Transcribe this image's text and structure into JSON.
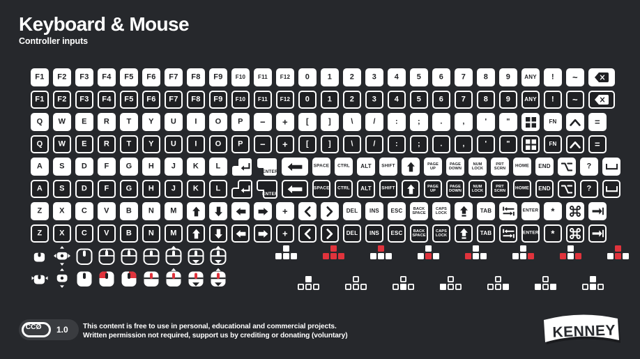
{
  "header": {
    "title": "Keyboard & Mouse",
    "subtitle": "Controller inputs"
  },
  "colors": {
    "background": "#26282c",
    "key_fill": "#ffffff",
    "key_dark": "#1f2023",
    "accent_red": "#e0333c",
    "badge_bg": "#3a3c40"
  },
  "keyboard": {
    "rows": [
      {
        "style": "solid",
        "keys": [
          {
            "label": "F1"
          },
          {
            "label": "F2"
          },
          {
            "label": "F3"
          },
          {
            "label": "F4"
          },
          {
            "label": "F5"
          },
          {
            "label": "F6"
          },
          {
            "label": "F7"
          },
          {
            "label": "F8"
          },
          {
            "label": "F9"
          },
          {
            "label": "F10"
          },
          {
            "label": "F11"
          },
          {
            "label": "F12"
          },
          {
            "label": "0"
          },
          {
            "label": "1"
          },
          {
            "label": "2"
          },
          {
            "label": "3"
          },
          {
            "label": "4"
          },
          {
            "label": "5"
          },
          {
            "label": "6"
          },
          {
            "label": "7"
          },
          {
            "label": "8"
          },
          {
            "label": "9"
          },
          {
            "label": "ANY"
          },
          {
            "label": "!"
          },
          {
            "label": "~"
          },
          {
            "label": "",
            "icon": "backspace-icon"
          }
        ]
      },
      {
        "style": "outline",
        "keys": [
          {
            "label": "F1"
          },
          {
            "label": "F2"
          },
          {
            "label": "F3"
          },
          {
            "label": "F4"
          },
          {
            "label": "F5"
          },
          {
            "label": "F6"
          },
          {
            "label": "F7"
          },
          {
            "label": "F8"
          },
          {
            "label": "F9"
          },
          {
            "label": "F10"
          },
          {
            "label": "F11"
          },
          {
            "label": "F12"
          },
          {
            "label": "0"
          },
          {
            "label": "1"
          },
          {
            "label": "2"
          },
          {
            "label": "3"
          },
          {
            "label": "4"
          },
          {
            "label": "5"
          },
          {
            "label": "6"
          },
          {
            "label": "7"
          },
          {
            "label": "8"
          },
          {
            "label": "9"
          },
          {
            "label": "ANY"
          },
          {
            "label": "!"
          },
          {
            "label": "~"
          },
          {
            "label": "",
            "icon": "backspace-icon"
          }
        ]
      },
      {
        "style": "solid",
        "keys": [
          {
            "label": "Q"
          },
          {
            "label": "W"
          },
          {
            "label": "E"
          },
          {
            "label": "R"
          },
          {
            "label": "T"
          },
          {
            "label": "Y"
          },
          {
            "label": "U"
          },
          {
            "label": "I"
          },
          {
            "label": "O"
          },
          {
            "label": "P"
          },
          {
            "label": "−"
          },
          {
            "label": "+"
          },
          {
            "label": "["
          },
          {
            "label": "]"
          },
          {
            "label": "\\"
          },
          {
            "label": "/"
          },
          {
            "label": ":"
          },
          {
            "label": ";"
          },
          {
            "label": "."
          },
          {
            "label": ","
          },
          {
            "label": "'"
          },
          {
            "label": "\""
          },
          {
            "label": "",
            "icon": "windows-icon"
          },
          {
            "label": "FN"
          },
          {
            "label": "",
            "icon": "caret-up-icon"
          },
          {
            "label": "="
          }
        ]
      },
      {
        "style": "outline",
        "keys": [
          {
            "label": "Q"
          },
          {
            "label": "W"
          },
          {
            "label": "E"
          },
          {
            "label": "R"
          },
          {
            "label": "T"
          },
          {
            "label": "Y"
          },
          {
            "label": "U"
          },
          {
            "label": "I"
          },
          {
            "label": "O"
          },
          {
            "label": "P"
          },
          {
            "label": "−"
          },
          {
            "label": "+"
          },
          {
            "label": "["
          },
          {
            "label": "]"
          },
          {
            "label": "\\"
          },
          {
            "label": "/"
          },
          {
            "label": ":"
          },
          {
            "label": ";"
          },
          {
            "label": "."
          },
          {
            "label": ","
          },
          {
            "label": "'"
          },
          {
            "label": "\""
          },
          {
            "label": "",
            "icon": "windows-icon"
          },
          {
            "label": "FN"
          },
          {
            "label": "",
            "icon": "caret-up-icon"
          },
          {
            "label": "="
          }
        ]
      },
      {
        "style": "solid",
        "keys": [
          {
            "label": "A"
          },
          {
            "label": "S"
          },
          {
            "label": "D"
          },
          {
            "label": "F"
          },
          {
            "label": "G"
          },
          {
            "label": "H"
          },
          {
            "label": "J"
          },
          {
            "label": "K"
          },
          {
            "label": "L"
          },
          {
            "label": "",
            "icon": "enter-arrow-icon"
          },
          {
            "label": "ENTER",
            "icon": "enter-text-icon"
          },
          {
            "label": "",
            "icon": "arrow-left-wide-icon"
          },
          {
            "label": "SPACE"
          },
          {
            "label": "CTRL"
          },
          {
            "label": "ALT"
          },
          {
            "label": "SHIFT"
          },
          {
            "label": "",
            "icon": "arrow-up-icon"
          },
          {
            "label": "PAGE UP"
          },
          {
            "label": "PAGE DOWN"
          },
          {
            "label": "NUM LOCK"
          },
          {
            "label": "PRT SCRN"
          },
          {
            "label": "HOME"
          },
          {
            "label": "END"
          },
          {
            "label": "",
            "icon": "option-icon"
          },
          {
            "label": "?"
          },
          {
            "label": "",
            "icon": "spacebar-icon"
          }
        ]
      },
      {
        "style": "outline",
        "keys": [
          {
            "label": "A"
          },
          {
            "label": "S"
          },
          {
            "label": "D"
          },
          {
            "label": "F"
          },
          {
            "label": "G"
          },
          {
            "label": "H"
          },
          {
            "label": "J"
          },
          {
            "label": "K"
          },
          {
            "label": "L"
          },
          {
            "label": "",
            "icon": "enter-arrow-icon"
          },
          {
            "label": "ENTER",
            "icon": "enter-text-icon"
          },
          {
            "label": "",
            "icon": "arrow-left-wide-icon"
          },
          {
            "label": "SPACE"
          },
          {
            "label": "CTRL"
          },
          {
            "label": "ALT"
          },
          {
            "label": "SHIFT"
          },
          {
            "label": "",
            "icon": "arrow-up-icon"
          },
          {
            "label": "PAGE UP"
          },
          {
            "label": "PAGE DOWN"
          },
          {
            "label": "NUM LOCK"
          },
          {
            "label": "PRT SCRN"
          },
          {
            "label": "HOME"
          },
          {
            "label": "END"
          },
          {
            "label": "",
            "icon": "option-icon"
          },
          {
            "label": "?"
          },
          {
            "label": "",
            "icon": "spacebar-icon"
          }
        ]
      },
      {
        "style": "solid",
        "keys": [
          {
            "label": "Z"
          },
          {
            "label": "X"
          },
          {
            "label": "C"
          },
          {
            "label": "V"
          },
          {
            "label": "B"
          },
          {
            "label": "N"
          },
          {
            "label": "M"
          },
          {
            "label": "",
            "icon": "arrow-up-icon"
          },
          {
            "label": "",
            "icon": "arrow-down-icon"
          },
          {
            "label": "",
            "icon": "arrow-left-icon"
          },
          {
            "label": "",
            "icon": "arrow-right-icon"
          },
          {
            "label": "+"
          },
          {
            "label": "",
            "icon": "chevron-left-icon"
          },
          {
            "label": "",
            "icon": "chevron-right-icon"
          },
          {
            "label": "DEL"
          },
          {
            "label": "INS"
          },
          {
            "label": "ESC"
          },
          {
            "label": "BACK SPACE"
          },
          {
            "label": "CAPS LOCK"
          },
          {
            "label": "",
            "icon": "shift-bar-icon"
          },
          {
            "label": "TAB"
          },
          {
            "label": "",
            "icon": "tab-left-icon"
          },
          {
            "label": "ENTER",
            "icon": "enter-text-icon"
          },
          {
            "label": "*"
          },
          {
            "label": "",
            "icon": "command-icon"
          },
          {
            "label": "",
            "icon": "tab-right-icon"
          }
        ]
      },
      {
        "style": "outline",
        "keys": [
          {
            "label": "Z"
          },
          {
            "label": "X"
          },
          {
            "label": "C"
          },
          {
            "label": "V"
          },
          {
            "label": "B"
          },
          {
            "label": "N"
          },
          {
            "label": "M"
          },
          {
            "label": "",
            "icon": "arrow-up-icon"
          },
          {
            "label": "",
            "icon": "arrow-down-icon"
          },
          {
            "label": "",
            "icon": "arrow-left-icon"
          },
          {
            "label": "",
            "icon": "arrow-right-icon"
          },
          {
            "label": "+"
          },
          {
            "label": "",
            "icon": "chevron-left-icon"
          },
          {
            "label": "",
            "icon": "chevron-right-icon"
          },
          {
            "label": "DEL"
          },
          {
            "label": "INS"
          },
          {
            "label": "ESC"
          },
          {
            "label": "BACK SPACE"
          },
          {
            "label": "CAPS LOCK"
          },
          {
            "label": "",
            "icon": "shift-bar-icon"
          },
          {
            "label": "TAB"
          },
          {
            "label": "",
            "icon": "tab-left-icon"
          },
          {
            "label": "ENTER",
            "icon": "enter-text-icon"
          },
          {
            "label": "*"
          },
          {
            "label": "",
            "icon": "command-icon"
          },
          {
            "label": "",
            "icon": "tab-right-icon"
          }
        ]
      }
    ]
  },
  "mice": {
    "row_outline": [
      {
        "name": "mouse-small-icon"
      },
      {
        "name": "mouse-move-all-directions-icon"
      },
      {
        "name": "mouse-plain-icon"
      },
      {
        "name": "mouse-left-button-icon"
      },
      {
        "name": "mouse-right-button-icon"
      },
      {
        "name": "mouse-scroll-wheel-icon"
      },
      {
        "name": "mouse-scroll-up-icon"
      },
      {
        "name": "mouse-scroll-down-icon"
      },
      {
        "name": "mouse-scroll-updown-icon"
      }
    ],
    "row_solid": [
      {
        "name": "mouse-small-horizontal-icon"
      },
      {
        "name": "mouse-move-vertical-icon"
      },
      {
        "name": "mouse-plain-filled-icon"
      },
      {
        "name": "mouse-left-button-filled-icon"
      },
      {
        "name": "mouse-right-button-filled-icon"
      },
      {
        "name": "mouse-scroll-wheel-filled-icon"
      },
      {
        "name": "mouse-scroll-up-filled-icon"
      },
      {
        "name": "mouse-scroll-down-filled-icon"
      },
      {
        "name": "mouse-scroll-updown-filled-icon"
      }
    ]
  },
  "clusters": {
    "row_solid": [
      {
        "name": "wasd-cluster-none-icon",
        "highlight": "none"
      },
      {
        "name": "wasd-cluster-all-icon",
        "highlight": "all"
      },
      {
        "name": "wasd-cluster-up-icon",
        "highlight": "up"
      },
      {
        "name": "wasd-cluster-down-icon",
        "highlight": "down"
      },
      {
        "name": "wasd-cluster-left-icon",
        "highlight": "left"
      },
      {
        "name": "wasd-cluster-right-icon",
        "highlight": "right"
      },
      {
        "name": "wasd-cluster-leftright-icon",
        "highlight": "leftright"
      },
      {
        "name": "wasd-cluster-updown-icon",
        "highlight": "updown"
      }
    ],
    "row_outline": [
      {
        "name": "wasd-cluster-outline-up-icon",
        "highlight": "up"
      },
      {
        "name": "wasd-cluster-outline-none-icon",
        "highlight": "none"
      },
      {
        "name": "wasd-cluster-outline-down-icon",
        "highlight": "down"
      },
      {
        "name": "wasd-cluster-outline-left-icon",
        "highlight": "left"
      },
      {
        "name": "wasd-cluster-outline-right-icon",
        "highlight": "right"
      },
      {
        "name": "wasd-cluster-outline-leftright-icon",
        "highlight": "leftright"
      },
      {
        "name": "wasd-cluster-outline-updown-icon",
        "highlight": "updown"
      }
    ]
  },
  "footer": {
    "cc0_label": "CCØ",
    "version": "1.0",
    "license_line1": "This content is free to use in personal, educational and commercial projects.",
    "license_line2": "Written permission not required, support us by crediting or donating (voluntary)",
    "brand": "KENNEY"
  }
}
